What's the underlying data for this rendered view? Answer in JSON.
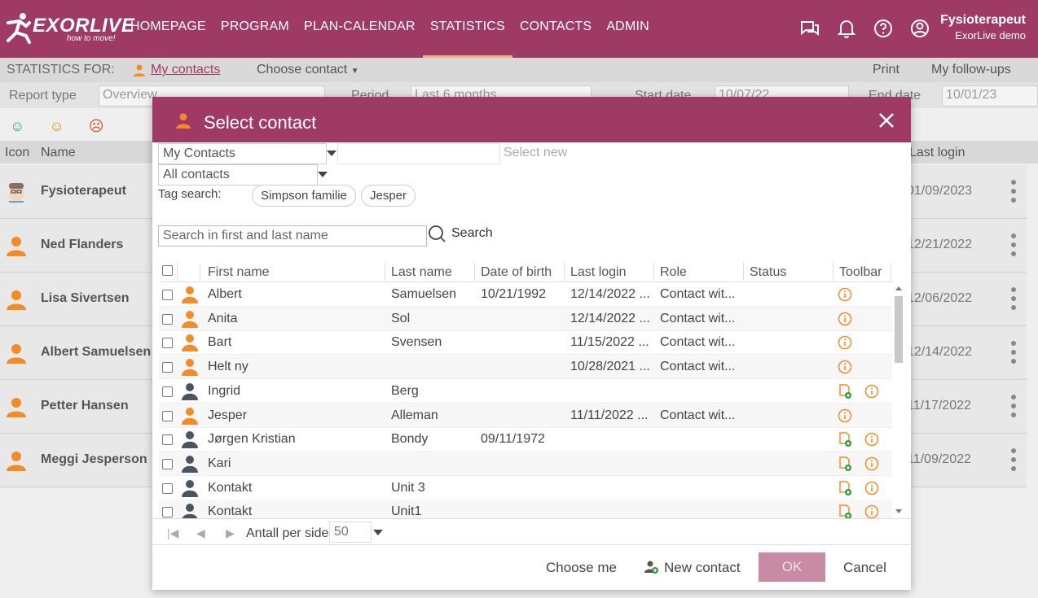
{
  "app": {
    "logo_text": "EXORLIVE",
    "logo_tagline": "how to move!",
    "nav": [
      "HOMEPAGE",
      "PROGRAM",
      "PLAN-CALENDAR",
      "STATISTICS",
      "CONTACTS",
      "ADMIN"
    ],
    "active_nav": "STATISTICS",
    "user_name": "Fysioterapeut",
    "user_company": "ExorLive demo",
    "accent": "#9e3a64"
  },
  "stats_bar": {
    "label": "STATISTICS FOR:",
    "my_contacts": "My contacts",
    "choose_contact": "Choose contact",
    "print": "Print",
    "follow_ups": "My follow-ups"
  },
  "filter_bar": {
    "report_type_label": "Report type",
    "report_type_value": "Overview",
    "period_label": "Period",
    "period_value": "Last 6 months",
    "start_label": "Start date",
    "start_value": "10/07/22",
    "end_label": "End date",
    "end_value": "10/01/23"
  },
  "bg_table": {
    "col_icon": "Icon",
    "col_name": "Name",
    "col_last_login": "Last login",
    "rows": [
      {
        "name": "Fysioterapeut",
        "last_login": "01/09/2023"
      },
      {
        "name": "Ned Flanders",
        "last_login": "12/21/2022"
      },
      {
        "name": "Lisa Sivertsen",
        "last_login": "12/06/2022"
      },
      {
        "name": "Albert Samuelsen",
        "last_login": "12/14/2022"
      },
      {
        "name": "Petter Hansen",
        "last_login": "11/17/2022"
      },
      {
        "name": "Meggi Jesperson",
        "last_login": "11/09/2022"
      }
    ]
  },
  "dialog": {
    "title": "Select contact",
    "contacts_select": "My Contacts",
    "select_new_placeholder": "Select new",
    "filter_select": "All contacts",
    "tag_search_label": "Tag search:",
    "tags": [
      "Simpson familie",
      "Jesper"
    ],
    "search_placeholder": "Search in first and last name",
    "search_button": "Search",
    "columns": {
      "first_name": "First name",
      "last_name": "Last name",
      "dob": "Date of birth",
      "last_login": "Last login",
      "role": "Role",
      "status": "Status",
      "toolbar": "Toolbar"
    },
    "rows": [
      {
        "first": "Albert",
        "last": "Samuelsen",
        "dob": "10/21/1992",
        "login": "12/14/2022 ...",
        "role": "Contact wit...",
        "type": "user"
      },
      {
        "first": "Anita",
        "last": "Sol",
        "dob": "",
        "login": "12/14/2022 ...",
        "role": "Contact wit...",
        "type": "user"
      },
      {
        "first": "Bart",
        "last": "Svensen",
        "dob": "",
        "login": "11/15/2022 ...",
        "role": "Contact wit...",
        "type": "user"
      },
      {
        "first": "Helt ny",
        "last": "",
        "dob": "",
        "login": "10/28/2021 ...",
        "role": "Contact wit...",
        "type": "user"
      },
      {
        "first": "Ingrid",
        "last": "Berg",
        "dob": "",
        "login": "",
        "role": "",
        "type": "contact"
      },
      {
        "first": "Jesper",
        "last": "Alleman",
        "dob": "",
        "login": "11/11/2022 ...",
        "role": "Contact wit...",
        "type": "user"
      },
      {
        "first": "Jørgen Kristian",
        "last": "Bondy",
        "dob": "09/11/1972",
        "login": "",
        "role": "",
        "type": "contact"
      },
      {
        "first": "Kari",
        "last": "",
        "dob": "",
        "login": "",
        "role": "",
        "type": "contact"
      },
      {
        "first": "Kontakt",
        "last": "Unit 3",
        "dob": "",
        "login": "",
        "role": "",
        "type": "contact"
      },
      {
        "first": "Kontakt",
        "last": "Unit1",
        "dob": "",
        "login": "",
        "role": "",
        "type": "contact"
      }
    ],
    "per_page_label": "Antall per side",
    "per_page_value": "50",
    "choose_me": "Choose me",
    "new_contact": "New contact",
    "ok": "OK",
    "cancel": "Cancel"
  },
  "colors": {
    "user_icon": "#f28c28",
    "contact_icon": "#4a5563",
    "info_icon": "#f28c28",
    "add_icon": "#2e9b3f"
  }
}
